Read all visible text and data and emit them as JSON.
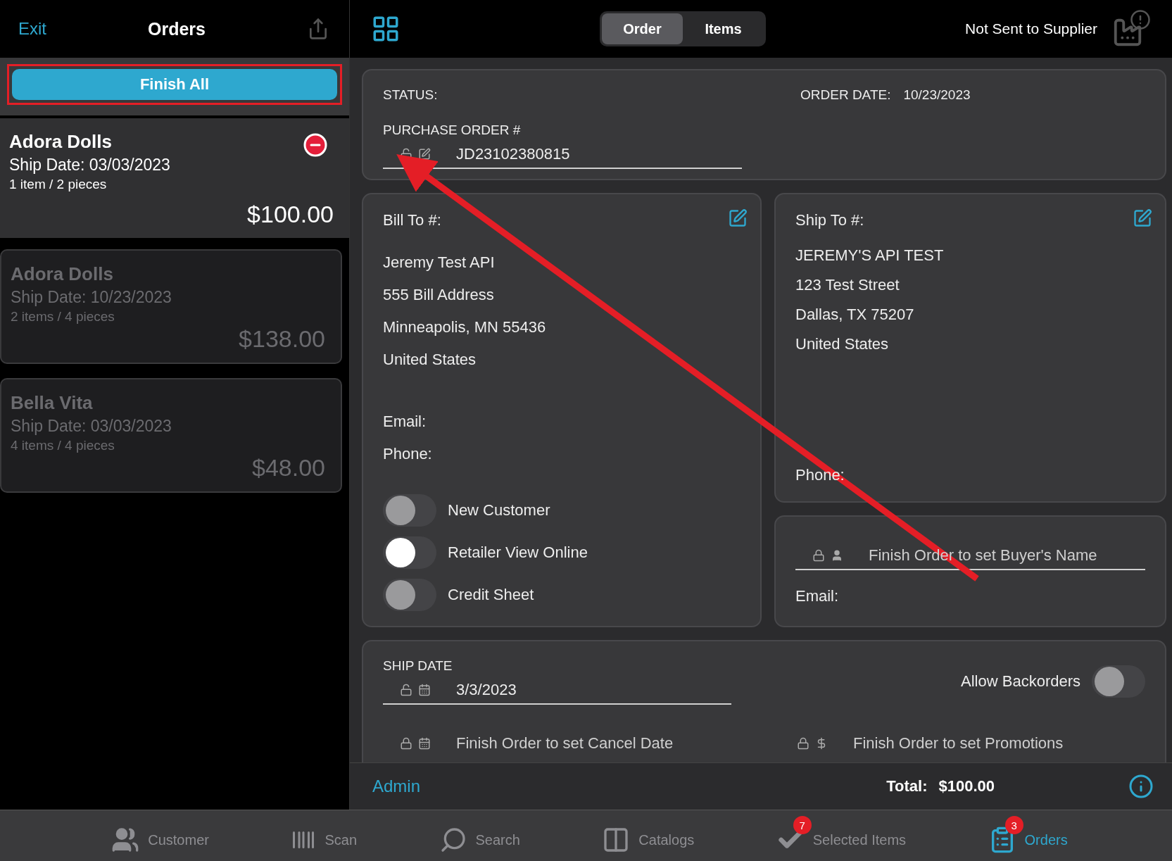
{
  "header": {
    "exit": "Exit",
    "title": "Orders",
    "segments": [
      {
        "label": "Order",
        "selected": true
      },
      {
        "label": "Items",
        "selected": false
      }
    ],
    "status": "Not Sent to Supplier"
  },
  "finish_all": "Finish All",
  "orders": [
    {
      "name": "Adora Dolls",
      "ship_date": "Ship Date: 03/03/2023",
      "count": "1 item / 2 pieces",
      "total": "$100.00",
      "selected": true
    },
    {
      "name": "Adora Dolls",
      "ship_date": "Ship Date: 10/23/2023",
      "count": "2 items / 4 pieces",
      "total": "$138.00",
      "selected": false
    },
    {
      "name": "Bella Vita",
      "ship_date": "Ship Date: 03/03/2023",
      "count": "4 items / 4 pieces",
      "total": "$48.00",
      "selected": false
    }
  ],
  "order": {
    "status_label": "STATUS:",
    "order_date_label": "ORDER DATE:",
    "order_date": "10/23/2023",
    "po_label": "PURCHASE ORDER #",
    "po_value": "JD23102380815",
    "bill_to": {
      "title": "Bill To #:",
      "lines": [
        "Jeremy Test API",
        "555 Bill Address",
        "Minneapolis, MN  55436",
        "United States"
      ],
      "email": "Email:",
      "phone": "Phone:"
    },
    "toggles": [
      {
        "label": "New Customer",
        "on": false
      },
      {
        "label": "Retailer View Online",
        "on": true
      },
      {
        "label": "Credit Sheet",
        "on": false
      }
    ],
    "ship_to": {
      "title": "Ship To #:",
      "lines": [
        "JEREMY'S API TEST",
        "123 Test Street",
        "Dallas, TX  75207",
        "United States"
      ],
      "phone": "Phone:"
    },
    "buyer": {
      "placeholder": "Finish Order to set Buyer's Name",
      "email": "Email:"
    },
    "ship_date": {
      "label": "SHIP DATE",
      "value": "3/3/2023"
    },
    "allow_backorders": {
      "label": "Allow Backorders",
      "on": false
    },
    "cancel_date": "Finish Order to set Cancel Date",
    "promotions": "Finish Order to set Promotions"
  },
  "footer": {
    "admin": "Admin",
    "total_label": "Total:",
    "total": "$100.00"
  },
  "tabs": [
    {
      "kind": "customer",
      "label": "Customer",
      "selected": false
    },
    {
      "kind": "scan",
      "label": "Scan",
      "selected": false
    },
    {
      "kind": "search",
      "label": "Search",
      "selected": false
    },
    {
      "kind": "catalogs",
      "label": "Catalogs",
      "selected": false
    },
    {
      "kind": "selected",
      "label": "Selected Items",
      "badge": "7",
      "selected": false
    },
    {
      "kind": "orders",
      "label": "Orders",
      "badge": "3",
      "selected": true
    }
  ]
}
